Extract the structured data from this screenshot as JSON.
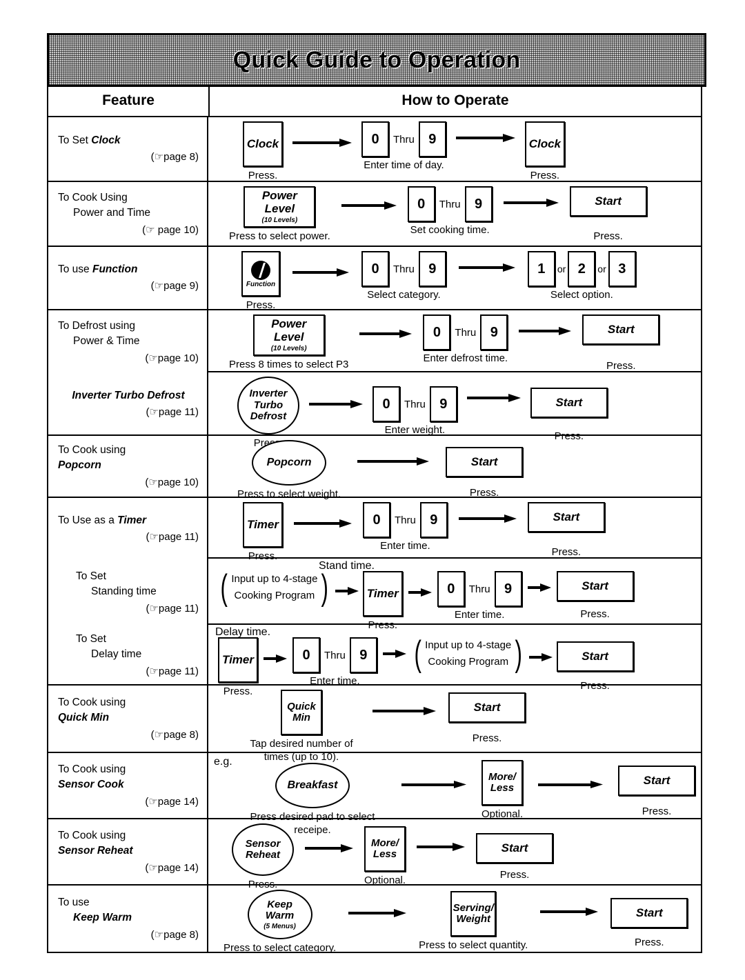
{
  "banner": {
    "title": "Quick Guide to Operation"
  },
  "headers": {
    "feature": "Feature",
    "how_to_operate": "How to Operate"
  },
  "labels": {
    "press": "Press.",
    "thru": "Thru",
    "or": "or",
    "optional": "Optional.",
    "eg": "e.g.",
    "stand_time": "Stand time.",
    "delay_time": "Delay time.",
    "enter_time_of_day": "Enter time of day.",
    "press_select_power": "Press to select power.",
    "set_cooking_time": "Set cooking time.",
    "select_category": "Select category.",
    "select_option": "Select option.",
    "press_8_times": "Press 8 times to select P3",
    "enter_defrost_time": "Enter defrost time.",
    "enter_weight": "Enter weight.",
    "press_select_weight": "Press to select weight.",
    "enter_time": "Enter time.",
    "tap_desired": "Tap desired number\nof times (up to 10).",
    "press_desired_pad": "Press desired pad to select receipe.",
    "press_select_category": "Press to select category.",
    "press_select_quantity": "Press to select quantity."
  },
  "keys": {
    "clock": "Clock",
    "power_level_l1": "Power",
    "power_level_l2": "Level",
    "power_level_sub": "(10 Levels)",
    "function": "Function",
    "start": "Start",
    "timer": "Timer",
    "quick_l1": "Quick",
    "quick_l2": "Min",
    "more_l1": "More/",
    "more_l2": "Less",
    "serving_l1": "Serving/",
    "serving_l2": "Weight",
    "inverter_l1": "Inverter",
    "inverter_l2": "Turbo",
    "inverter_l3": "Defrost",
    "popcorn": "Popcorn",
    "breakfast": "Breakfast",
    "sensor_l1": "Sensor",
    "sensor_l2": "Reheat",
    "keep_l1": "Keep",
    "keep_l2": "Warm",
    "keep_sub": "(5 Menus)",
    "n0": "0",
    "n9": "9",
    "n1": "1",
    "n2": "2",
    "n3": "3",
    "program_l1": "Input up to 4-stage",
    "program_l2": "Cooking Program"
  },
  "rows": [
    {
      "feature": {
        "l1": "To Set ",
        "l1i": "Clock",
        "l2": "",
        "page": "(☞page 8)"
      }
    },
    {
      "feature": {
        "l1": "To Cook Using",
        "l1i": "",
        "l2": "Power and Time",
        "page": "(☞ page 10)"
      }
    },
    {
      "feature": {
        "l1": "To use ",
        "l1i": "Function",
        "l2": "",
        "page": "(☞page 9)"
      }
    },
    {
      "feature": {
        "l1": "To Defrost using",
        "l1i": "",
        "l2": "Power & Time",
        "page": "(☞page 10)"
      }
    },
    {
      "feature": {
        "l1": "",
        "l1i": "Inverter Turbo Defrost",
        "l2": "",
        "page": "(☞page 11)"
      }
    },
    {
      "feature": {
        "l1": "To Cook using",
        "l1i": "",
        "l2i": "Popcorn",
        "page": "(☞page 10)"
      }
    },
    {
      "feature": {
        "l1": "To Use as a ",
        "l1i": "Timer",
        "l2": "",
        "page": "(☞page 11)"
      }
    },
    {
      "feature": {
        "l1": "To Set",
        "l1i": "",
        "l2": "Standing time",
        "page": "(☞page 11)"
      }
    },
    {
      "feature": {
        "l1": "To Set",
        "l1i": "",
        "l2": "Delay time",
        "page": "(☞page 11)"
      }
    },
    {
      "feature": {
        "l1": "To Cook using",
        "l1i": "",
        "l2i": "Quick Min",
        "page": "(☞page 8)"
      }
    },
    {
      "feature": {
        "l1": "To Cook using",
        "l1i": "",
        "l2i": "Sensor Cook",
        "page": "(☞page 14)"
      }
    },
    {
      "feature": {
        "l1": "To Cook using",
        "l1i": "",
        "l2i": "Sensor Reheat",
        "page": "(☞page 14)"
      }
    },
    {
      "feature": {
        "l1": "To use",
        "l1i": "",
        "l2i": "Keep Warm",
        "page": "(☞page 8)"
      }
    }
  ]
}
